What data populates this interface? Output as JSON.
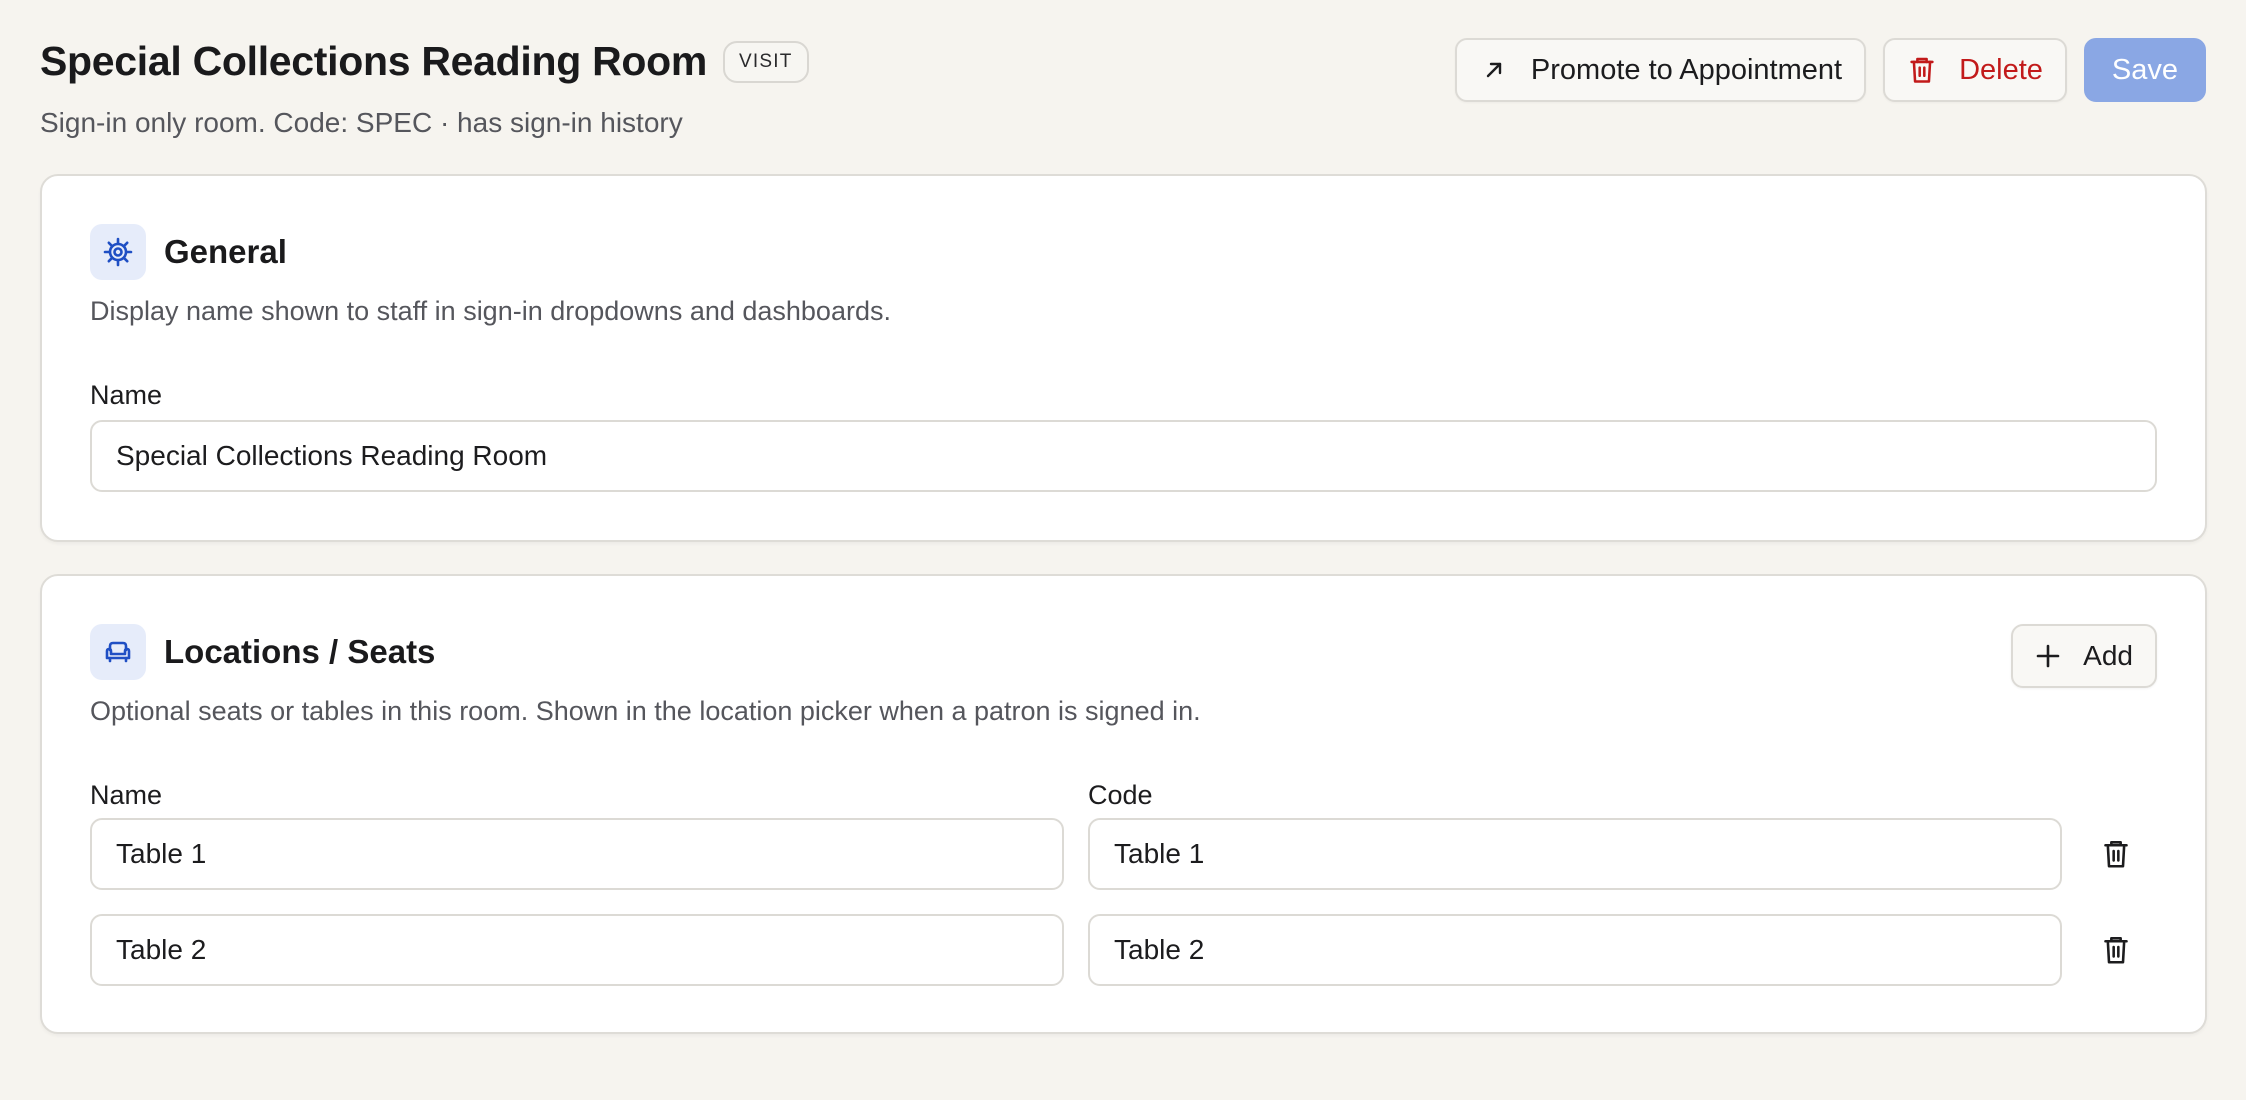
{
  "header": {
    "title": "Special Collections Reading Room",
    "badge": "VISIT",
    "subtitle": "Sign-in only room. Code: SPEC · has sign-in history"
  },
  "actions": {
    "promote_label": "Promote to Appointment",
    "delete_label": "Delete",
    "save_label": "Save"
  },
  "general": {
    "title": "General",
    "description": "Display name shown to staff in sign-in dropdowns and dashboards.",
    "name_label": "Name",
    "name_value": "Special Collections Reading Room",
    "icon": "gear-icon"
  },
  "locations": {
    "title": "Locations / Seats",
    "description": "Optional seats or tables in this room. Shown in the location picker when a patron is signed in.",
    "add_label": "Add",
    "name_header": "Name",
    "code_header": "Code",
    "icon": "armchair-icon",
    "rows": [
      {
        "name": "Table 1",
        "code": "Table 1"
      },
      {
        "name": "Table 2",
        "code": "Table 2"
      }
    ]
  },
  "colors": {
    "accent": "#1f4fc4",
    "danger": "#c21a1a",
    "save_bg": "#8aa7e4",
    "background": "#f6f4ef"
  }
}
